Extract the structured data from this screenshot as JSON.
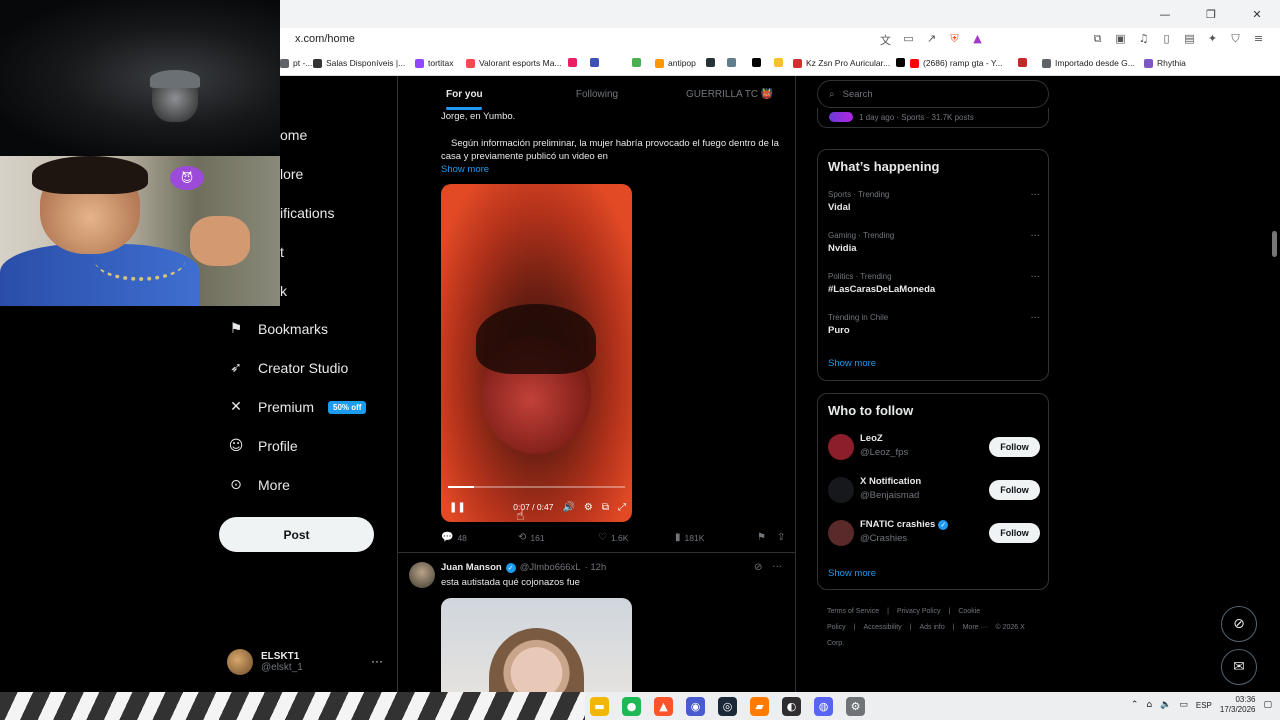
{
  "browser": {
    "url": "x.com/home",
    "window_controls": [
      "—",
      "❐",
      "✕"
    ],
    "bookmarks": [
      {
        "label": "pt -...",
        "color": "#5f6368"
      },
      {
        "label": "Salas Disponíveis |...",
        "color": "#333333"
      },
      {
        "label": "tortitax",
        "color": "#9146ff"
      },
      {
        "label": "Valorant esports Ma...",
        "color": "#ff4655"
      },
      {
        "label": "",
        "color": "#e91e63"
      },
      {
        "label": "",
        "color": "#3f51b5"
      },
      {
        "label": "",
        "color": "#4caf50"
      },
      {
        "label": "antipop",
        "color": "#ff9800"
      },
      {
        "label": "",
        "color": "#263238"
      },
      {
        "label": "",
        "color": "#607d8b"
      },
      {
        "label": "",
        "color": "#000000"
      },
      {
        "label": "",
        "color": "#fbc02d"
      },
      {
        "label": "Kz Zsn Pro Auricular...",
        "color": "#d32f2f"
      },
      {
        "label": "",
        "color": "#000000"
      },
      {
        "label": "(2686) ramp gta - Y...",
        "color": "#ff0000"
      },
      {
        "label": "",
        "color": "#c62828"
      },
      {
        "label": "Importado desde G...",
        "color": "#5f6368"
      },
      {
        "label": "Rhythia",
        "color": "#7e57c2"
      }
    ]
  },
  "nav": {
    "partial_items": [
      "ome",
      "lore",
      "ifications",
      "t",
      "k"
    ],
    "items": [
      {
        "label": "Bookmarks",
        "icon": "bookmark-icon",
        "glyph": "🔖"
      },
      {
        "label": "Creator Studio",
        "icon": "rocket-icon",
        "glyph": "🚀"
      },
      {
        "label": "Premium",
        "icon": "x-logo-icon",
        "glyph": "𝕏",
        "badge": "50% off"
      },
      {
        "label": "Profile",
        "icon": "person-icon",
        "glyph": "👤"
      },
      {
        "label": "More",
        "icon": "more-circle-icon",
        "glyph": "⋯"
      }
    ],
    "post_label": "Post",
    "account": {
      "name": "ELSKT1",
      "handle": "@elskt_1",
      "more": "···"
    }
  },
  "feed": {
    "tabs": [
      "For you",
      "Following",
      "GUERRILLA TC 👹"
    ],
    "tweet1": {
      "text_top": "Jorge, en Yumbo.",
      "text_body": "Según información preliminar, la mujer habría provocado el fuego dentro de la casa y previamente publicó un video en",
      "show_more": "Show more",
      "video": {
        "time": "0:07 / 0:47",
        "progress": 0.149
      },
      "actions": {
        "replies": "48",
        "reposts": "161",
        "likes": "1.6K",
        "views": "181K"
      }
    },
    "tweet2": {
      "name": "Juan Manson",
      "handle": "@Jlmbo666xL",
      "time": "· 12h",
      "text": "esta autistada qué cojonazos fue"
    }
  },
  "sidebar": {
    "search_placeholder": "Search",
    "top_trend_meta": "1 day ago · Sports · 31.7K posts",
    "happening_title": "What’s happening",
    "trends": [
      {
        "meta": "Sports · Trending",
        "name": "Vidal"
      },
      {
        "meta": "Gaming · Trending",
        "name": "Nvidia"
      },
      {
        "meta": "Politics · Trending",
        "name": "#LasCarasDeLaMoneda"
      },
      {
        "meta": "Trending in Chile",
        "name": "Puro"
      }
    ],
    "show_more": "Show more",
    "follow_title": "Who to follow",
    "follow": [
      {
        "name": "LeoZ",
        "handle": "@Leoz_fps",
        "verified": false,
        "avatar": "#8b1e2a"
      },
      {
        "name": "X Notification",
        "handle": "@Benjaismad",
        "verified": false,
        "avatar": "#16181c"
      },
      {
        "name": "FNATIC crashies",
        "handle": "@Crashies",
        "verified": true,
        "avatar": "#5a2a2a"
      }
    ],
    "follow_label": "Follow",
    "follow_show_more": "Show more",
    "footer": [
      "Terms of Service",
      "|",
      "Privacy Policy",
      "|",
      "Cookie Policy",
      "|",
      "Accessibility",
      "|",
      "Ads info",
      "|",
      "More ···",
      "© 2026 X Corp."
    ]
  },
  "taskbar": {
    "apps": [
      {
        "name": "file-explorer-icon",
        "color": "#f2b705"
      },
      {
        "name": "spotify-icon",
        "color": "#1db954"
      },
      {
        "name": "brave-icon",
        "color": "#fb542b"
      },
      {
        "name": "app-icon",
        "color": "#4a5bd1"
      },
      {
        "name": "steam-icon",
        "color": "#1b2838"
      },
      {
        "name": "sublime-icon",
        "color": "#ff7b00"
      },
      {
        "name": "obs-icon",
        "color": "#302e31"
      },
      {
        "name": "discord-icon",
        "color": "#5865f2"
      },
      {
        "name": "settings-icon",
        "color": "#6f7378"
      }
    ],
    "lang": "ESP",
    "time": "03:36",
    "date": "17/3/2026"
  }
}
